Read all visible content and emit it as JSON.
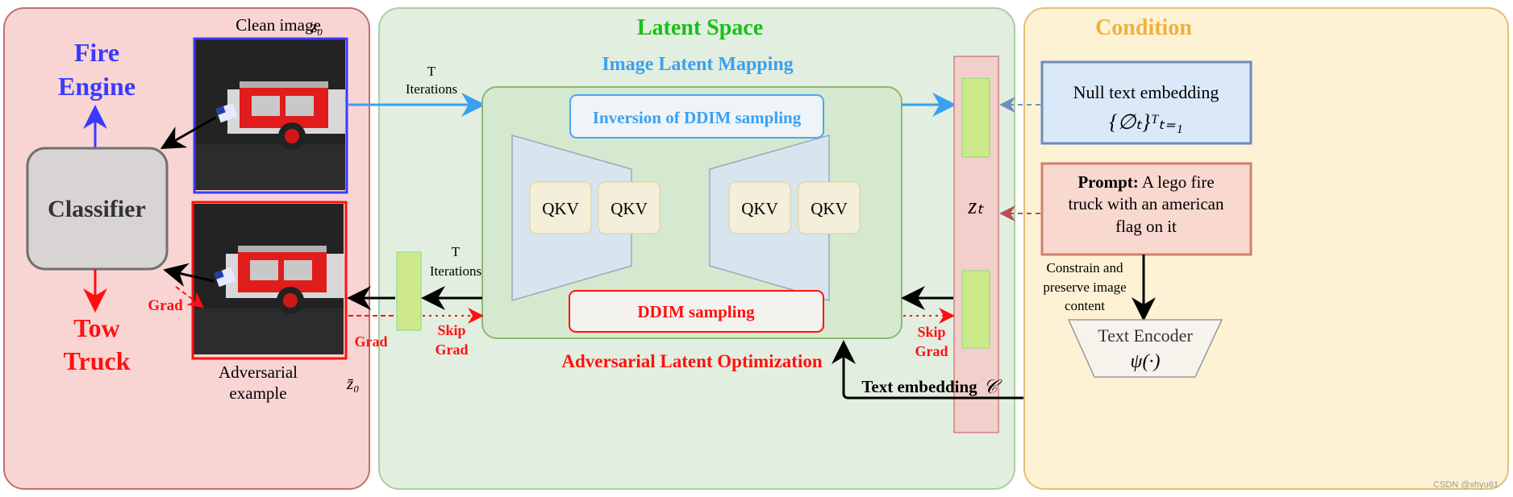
{
  "left_panel": {
    "label_clean": "Clean image",
    "sym_clean": "z₀",
    "label_adv_1": "Adversarial",
    "label_adv_2": "example",
    "sym_adv": "z̄₀",
    "classifier": "Classifier",
    "class_true_1": "Fire",
    "class_true_2": "Engine",
    "class_adv_1": "Tow",
    "class_adv_2": "Truck",
    "grad": "Grad"
  },
  "middle_panel": {
    "title": "Latent Space",
    "mapping_title": "Image Latent Mapping",
    "inversion": "Inversion of DDIM sampling",
    "qkv": [
      "QKV",
      "QKV",
      "QKV",
      "QKV"
    ],
    "ddim": "DDIM sampling",
    "optimization_title": "Adversarial Latent Optimization",
    "t_iter_top_1": "T",
    "t_iter_top_2": "Iterations",
    "t_iter_bottom_1": "T",
    "t_iter_bottom_2": "Iterations",
    "grad": "Grad",
    "skip_grad_left_1": "Skip",
    "skip_grad_left_2": "Grad",
    "skip_grad_right_1": "Skip",
    "skip_grad_right_2": "Grad",
    "zt": "zₜ",
    "text_embedding": "Text embedding",
    "text_embedding_sym": "𝒞"
  },
  "right_panel": {
    "title": "Condition",
    "null_text": "Null text embedding",
    "null_formula": "{∅ₜ}ᵀₜ₌₁",
    "prompt_label": "Prompt:",
    "prompt_1": " A lego fire",
    "prompt_2": "truck with an american",
    "prompt_3": "flag on it",
    "constrain_1": "Constrain and",
    "constrain_2": "preserve image",
    "constrain_3": "content",
    "encoder": "Text Encoder",
    "encoder_sym": "ψ(·)"
  },
  "watermark": "CSDN @xhyu61",
  "colors": {
    "blue": "#3a3aff",
    "red": "#ff1010",
    "green_title": "#18c018",
    "orange_title": "#f0b040",
    "light_blue": "#3aa0f0"
  }
}
